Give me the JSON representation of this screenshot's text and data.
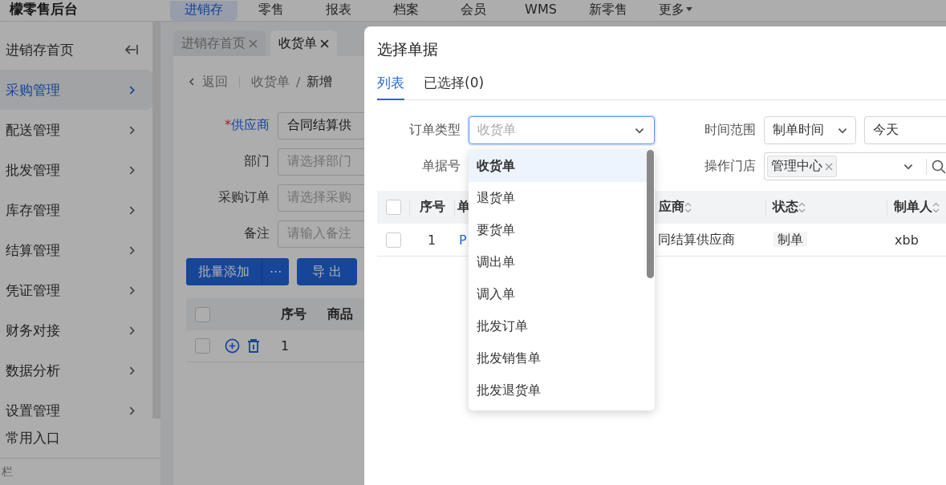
{
  "header": {
    "logo": "檬零售后台",
    "nav": [
      {
        "label": "进销存",
        "selected": true,
        "has_caret": false
      },
      {
        "label": "零售",
        "selected": false,
        "has_caret": false
      },
      {
        "label": "报表",
        "selected": false,
        "has_caret": false
      },
      {
        "label": "档案",
        "selected": false,
        "has_caret": false
      },
      {
        "label": "会员",
        "selected": false,
        "has_caret": false
      },
      {
        "label": "WMS",
        "selected": false,
        "has_caret": false
      },
      {
        "label": "新零售",
        "selected": false,
        "has_caret": false
      },
      {
        "label": "更多",
        "selected": false,
        "has_caret": true
      }
    ]
  },
  "sidebar": {
    "home": "进销存首页",
    "items": [
      {
        "label": "采购管理",
        "selected": true
      },
      {
        "label": "配送管理",
        "selected": false
      },
      {
        "label": "批发管理",
        "selected": false
      },
      {
        "label": "库存管理",
        "selected": false
      },
      {
        "label": "结算管理",
        "selected": false
      },
      {
        "label": "凭证管理",
        "selected": false
      },
      {
        "label": "财务对接",
        "selected": false
      },
      {
        "label": "数据分析",
        "selected": false
      },
      {
        "label": "设置管理",
        "selected": false
      }
    ],
    "section": "常用入口",
    "footer": "栏"
  },
  "tabs": [
    {
      "label": "进销存首页",
      "selected": false
    },
    {
      "label": "收货单",
      "selected": true
    }
  ],
  "breadcrumb": {
    "back": "返回",
    "parent": "收货单",
    "separator": "/",
    "current": "新增"
  },
  "form": [
    {
      "label": "供应商",
      "required_mark": "*",
      "highlighted": true,
      "value": "合同结算供"
    },
    {
      "label": "部门",
      "highlighted": false,
      "placeholder": "请选择部门"
    },
    {
      "label": "采购订单",
      "highlighted": false,
      "placeholder": "请选择采购"
    },
    {
      "label": "备注",
      "highlighted": false,
      "placeholder": "请输入备注"
    }
  ],
  "actions": {
    "primary": "批量添加",
    "more": "···",
    "export": "导 出"
  },
  "grid": {
    "all_checked": false,
    "columns": [
      "序号",
      "商品"
    ],
    "rows": [
      {
        "checked": false,
        "index": "1"
      }
    ]
  },
  "modal": {
    "title": "选择单据",
    "tabs": [
      {
        "label": "列表",
        "selected": true
      },
      {
        "label": "已选择(0)",
        "selected": false
      }
    ],
    "order_type": {
      "label": "订单类型",
      "placeholder": "收货单",
      "open": true,
      "options": [
        {
          "label": "收货单",
          "selected": true
        },
        {
          "label": "退货单",
          "selected": false
        },
        {
          "label": "要货单",
          "selected": false
        },
        {
          "label": "调出单",
          "selected": false
        },
        {
          "label": "调入单",
          "selected": false
        },
        {
          "label": "批发订单",
          "selected": false
        },
        {
          "label": "批发销售单",
          "selected": false
        },
        {
          "label": "批发退货单",
          "selected": false
        }
      ]
    },
    "doc_no": {
      "label": "单据号"
    },
    "time": {
      "label": "时间范围",
      "mode": "制单时间",
      "range": "今天"
    },
    "store": {
      "label": "操作门店",
      "tags": [
        "管理中心"
      ]
    },
    "table": {
      "all_checked": false,
      "columns": [
        {
          "label": "序号",
          "sortable": false
        },
        {
          "label": "单",
          "sortable": false
        },
        {
          "label": "应商",
          "sortable": true
        },
        {
          "label": "状态",
          "sortable": true
        },
        {
          "label": "制单人",
          "sortable": true
        }
      ],
      "rows": [
        {
          "checked": false,
          "index": "1",
          "doc": "P",
          "supplier": "同结算供应商",
          "status": "制单",
          "maker": "xbb"
        }
      ]
    }
  }
}
